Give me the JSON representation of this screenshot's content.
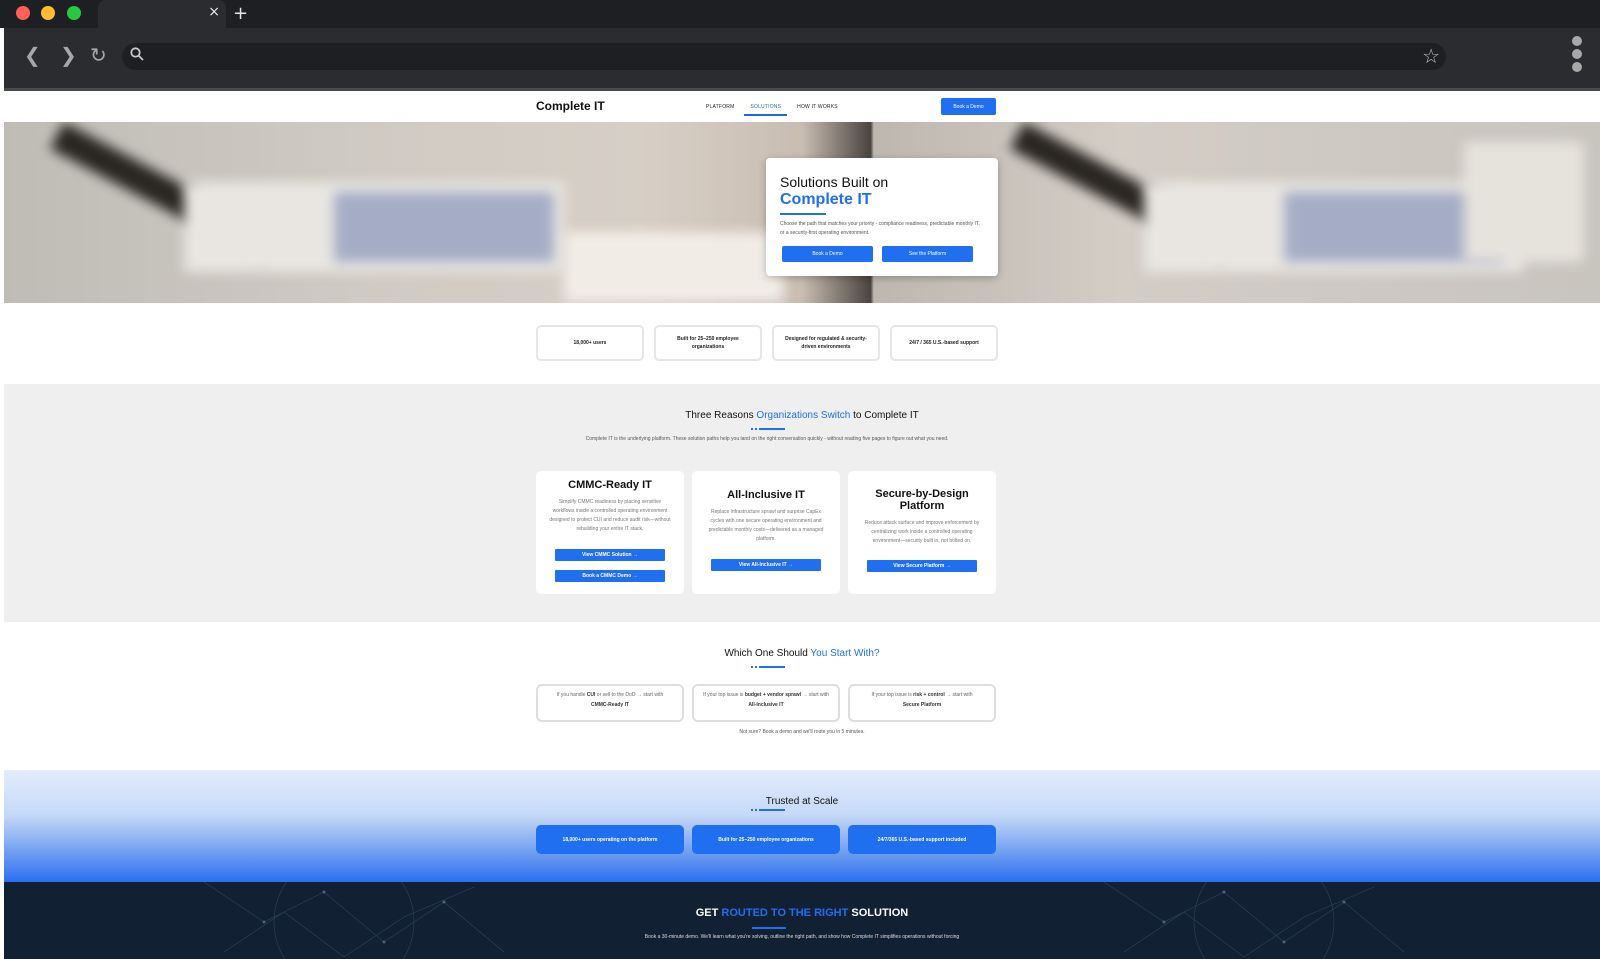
{
  "browser": {
    "tab_close": "×",
    "new_tab": "+"
  },
  "site": {
    "logo": "Complete IT",
    "nav": [
      {
        "label": "PLATFORM"
      },
      {
        "label": "SOLUTIONS"
      },
      {
        "label": "HOW IT WORKS"
      }
    ],
    "header_cta": "Book a Demo"
  },
  "hero": {
    "title_line1": "Solutions Built on",
    "title_line2": "Complete IT",
    "description": "Choose the path that matches your priority - compliance readiness, predictable monthly IT, or a security-first operating environment.",
    "primary_button": "Book a Demo",
    "secondary_button": "See the Platform"
  },
  "stats": [
    "18,000+ users",
    "Built for 25–250 employee organizations",
    "Designed for regulated & security-driven environments",
    "24/7 / 365 U.S.-based support"
  ],
  "reasons": {
    "title_pre": "Three Reasons ",
    "title_hl": "Organizations Switch",
    "title_post": " to Complete IT",
    "description": "Complete IT is the underlying platform. These solution paths help you land on the right conversation quickly - without reading five pages to figure out what you need.",
    "cards": [
      {
        "title": "CMMC-Ready IT",
        "description": "Simplify CMMC readiness by placing sensitive workflows inside a controlled operating environment designed to protect CUI and reduce audit risk—without rebuilding your entire IT stack.",
        "buttons": [
          "View CMMC Solution →",
          "Book a CMMC Demo →"
        ]
      },
      {
        "title": "All-Inclusive IT",
        "description": "Replace infrastructure sprawl and surprise CapEx cycles with one secure operating environment and predictable monthly costs—delivered as a managed platform.",
        "buttons": [
          "View All-Inclusive IT →"
        ]
      },
      {
        "title_line1": "Secure-by-Design",
        "title_line2": "Platform",
        "description": "Reduce attack surface and improve enforcement by centralizing work inside a controlled operating environment—security built in, not bolted on.",
        "buttons": [
          "View Secure Platform →"
        ]
      }
    ]
  },
  "which": {
    "title_pre": "Which One Should ",
    "title_hl": "You Start With?",
    "choices": [
      {
        "pre": "If you handle ",
        "b1": "CUI",
        "mid": " or sell to the DoD → start with ",
        "b2": "CMMC-Ready IT"
      },
      {
        "pre": "If your top issue is ",
        "b1": "budget + vendor sprawl",
        "mid": " → start with ",
        "b2": "All-Inclusive IT"
      },
      {
        "pre": "If your top issue is ",
        "b1": "risk + control",
        "mid": " → start with ",
        "b2": "Secure Platform"
      }
    ],
    "not_sure": "Not sure? Book a demo and we'll route you in 5 minutes."
  },
  "trusted": {
    "title": "Trusted at Scale",
    "buttons": [
      "18,000+ users operating on the platform",
      "Built for 25–250 employee organizations",
      "24/7/365 U.S.-based support included"
    ]
  },
  "cta": {
    "title_pre": "GET ",
    "title_hl": "ROUTED TO THE RIGHT",
    "title_post": " SOLUTION",
    "description": "Book a 30-minute demo. We'll learn what you're solving, outline the right path, and show how Complete IT simplifies operations without forcing"
  },
  "colors": {
    "accent": "#1f6ff0",
    "chrome_dark": "#1e1f22",
    "footer_bg": "#122033"
  }
}
